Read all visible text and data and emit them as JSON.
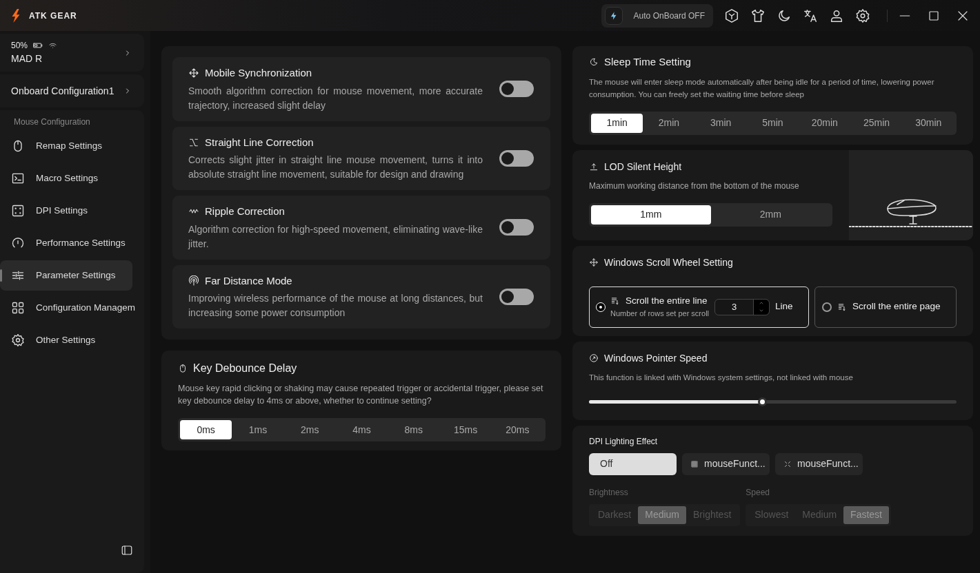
{
  "app": {
    "logo": "ATK GEAR"
  },
  "header": {
    "auto_onboard": {
      "label": "Auto OnBoard OFF",
      "on": false
    }
  },
  "device": {
    "battery": "50%",
    "name": "MAD R"
  },
  "config": {
    "label": "Onboard Configuration1"
  },
  "sidebar": {
    "section": "Mouse Configuration",
    "items": [
      {
        "label": "Remap Settings",
        "selected": false
      },
      {
        "label": "Macro Settings",
        "selected": false
      },
      {
        "label": "DPI Settings",
        "selected": false
      },
      {
        "label": "Performance Settings",
        "selected": false
      },
      {
        "label": "Parameter Settings",
        "selected": true
      },
      {
        "label": "Configuration Managem",
        "selected": false
      },
      {
        "label": "Other Settings",
        "selected": false
      }
    ]
  },
  "toggles": [
    {
      "title": "Mobile Synchronization",
      "description": "Smooth algorithm correction for mouse movement, more accurate trajectory, increased slight delay",
      "on": false
    },
    {
      "title": "Straight Line Correction",
      "description": "Corrects slight jitter in straight line mouse movement, turns it into absolute straight line movement, suitable for design and drawing",
      "on": false
    },
    {
      "title": "Ripple Correction",
      "description": "Algorithm correction for high-speed movement, eliminating wave-like jitter.",
      "on": false
    },
    {
      "title": "Far Distance Mode",
      "description": "Improving wireless performance of the mouse at long distances, but increasing some power consumption",
      "on": false
    }
  ],
  "debounce": {
    "title": "Key Debounce Delay",
    "description": "Mouse key rapid clicking or shaking may cause repeated trigger or accidental trigger, please set key debounce delay to 4ms or above, whether to continue setting?",
    "options": [
      {
        "label": "0ms",
        "selected": true
      },
      {
        "label": "1ms",
        "selected": false
      },
      {
        "label": "2ms",
        "selected": false
      },
      {
        "label": "4ms",
        "selected": false
      },
      {
        "label": "8ms",
        "selected": false
      },
      {
        "label": "15ms",
        "selected": false
      },
      {
        "label": "20ms",
        "selected": false
      }
    ]
  },
  "sleep": {
    "title": "Sleep Time Setting",
    "description": "The mouse will enter sleep mode automatically after being idle for a period of time, lowering power consumption. You can freely set the waiting time before sleep",
    "options": [
      {
        "label": "1min",
        "selected": true
      },
      {
        "label": "2min",
        "selected": false
      },
      {
        "label": "3min",
        "selected": false
      },
      {
        "label": "5min",
        "selected": false
      },
      {
        "label": "20min",
        "selected": false
      },
      {
        "label": "25min",
        "selected": false
      },
      {
        "label": "30min",
        "selected": false
      }
    ]
  },
  "lod": {
    "title": "LOD Silent Height",
    "description": "Maximum working distance from the bottom of the mouse",
    "options": [
      {
        "label": "1mm",
        "selected": true
      },
      {
        "label": "2mm",
        "selected": false
      }
    ]
  },
  "scroll": {
    "title": "Windows Scroll Wheel Setting",
    "options": [
      {
        "kind": "line",
        "label": "Scroll the entire line",
        "hint": "Number of rows set per scroll",
        "value": "3",
        "unit": "Line",
        "selected": true
      },
      {
        "kind": "page",
        "label": "Scroll the entire page",
        "selected": false
      }
    ]
  },
  "pointer": {
    "title": "Windows Pointer Speed",
    "description": "This function is linked with Windows system settings, not linked with mouse",
    "level": 0.47
  },
  "dpi_lighting": {
    "title": "DPI Lighting Effect",
    "effects": [
      {
        "kind": "off",
        "label": "Off",
        "selected": true
      },
      {
        "kind": "grid",
        "label": "mouseFunct...",
        "selected": false
      },
      {
        "kind": "sparkle",
        "label": "mouseFunct...",
        "selected": false
      }
    ],
    "brightness": {
      "label": "Brightness",
      "disabled": true,
      "options": [
        {
          "label": "Darkest",
          "selected": false
        },
        {
          "label": "Medium",
          "selected": true
        },
        {
          "label": "Brightest",
          "selected": false
        }
      ]
    },
    "speed": {
      "label": "Speed",
      "disabled": true,
      "options": [
        {
          "label": "Slowest",
          "selected": false
        },
        {
          "label": "Medium",
          "selected": false
        },
        {
          "label": "Fastest",
          "selected": true
        }
      ]
    }
  }
}
